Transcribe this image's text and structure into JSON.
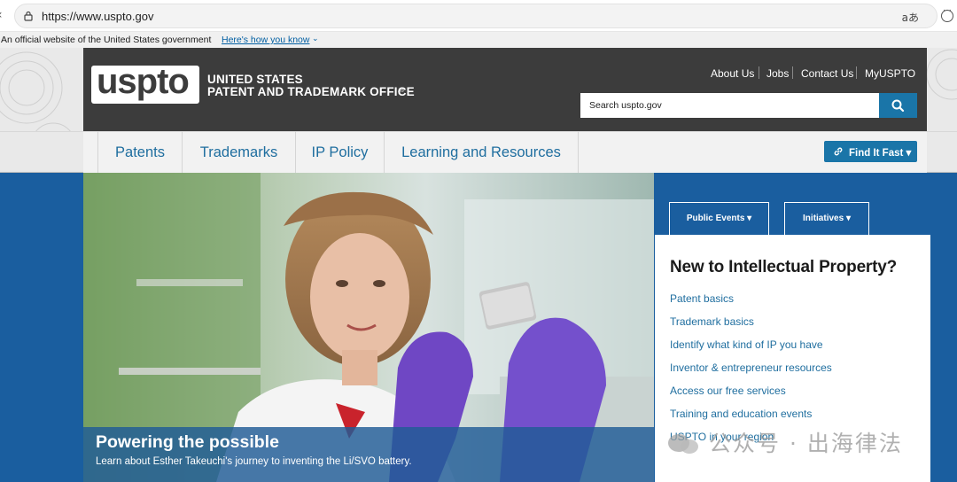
{
  "browser": {
    "url": "https://www.uspto.gov",
    "read_aloud_glyph": "aあ"
  },
  "gov_banner": {
    "text": "An official website of the United States government",
    "link": "Here's how you know",
    "chevron": "⌄"
  },
  "header": {
    "logo_text": "uspto",
    "agency_line1": "UNITED STATES",
    "agency_line2": "PATENT AND TRADEMARK OFFICE",
    "reg_mark": "®",
    "utility_links": [
      "About Us",
      "Jobs",
      "Contact Us",
      "MyUSPTO"
    ],
    "search_placeholder": "Search uspto.gov"
  },
  "nav": {
    "items": [
      "Patents",
      "Trademarks",
      "IP Policy",
      "Learning and Resources"
    ],
    "find_it_fast": "Find It Fast ▾"
  },
  "hero": {
    "title": "Powering the possible",
    "subtitle": "Learn about Esther Takeuchi's journey to inventing the Li/SVO battery."
  },
  "tabs": [
    "Public Events ▾",
    "Initiatives ▾"
  ],
  "side_panel": {
    "heading": "New to Intellectual Property?",
    "links": [
      "Patent basics",
      "Trademark basics",
      "Identify what kind of IP you have",
      "Inventor & entrepreneur resources",
      "Access our free services",
      "Training and education events",
      "USPTO in your region"
    ]
  },
  "watermark": "公众号 · 出海律法",
  "colors": {
    "header_dark": "#3c3c3c",
    "brand_blue": "#1a75a8",
    "link_blue": "#1f6e9f",
    "main_blue": "#1a5e9f"
  }
}
